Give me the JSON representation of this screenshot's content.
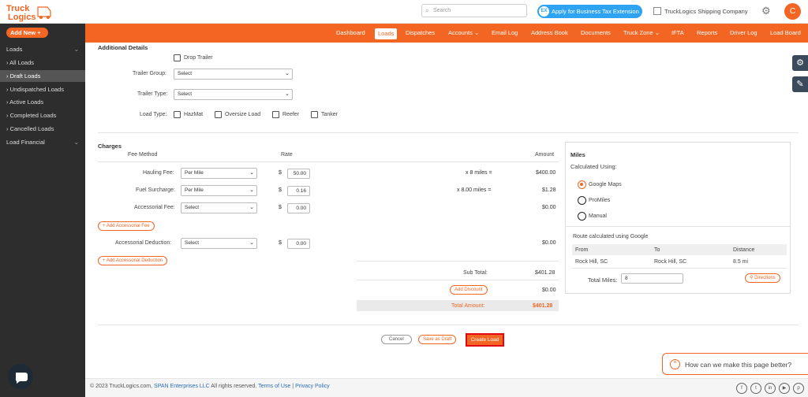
{
  "header": {
    "logo_text": "TruckLogics",
    "search_placeholder": "Search",
    "tax_button": "Apply for Business Tax Extension",
    "company": "TruckLogics Shipping Company",
    "avatar_initial": "C"
  },
  "sidebar": {
    "add_new": "Add New",
    "loads_header": "Loads",
    "items": [
      "All Loads",
      "Draft Loads",
      "Undispatched Loads",
      "Active Loads",
      "Completed Loads",
      "Cancelled Loads"
    ],
    "load_financial": "Load Financial"
  },
  "nav": [
    "Dashboard",
    "Loads",
    "Dispatches",
    "Accounts",
    "Email Log",
    "Address Book",
    "Documents",
    "Truck Zone",
    "IFTA",
    "Reports",
    "Driver Log",
    "Load Board"
  ],
  "additional": {
    "title": "Additional Details",
    "drop_trailer": "Drop Trailer",
    "trailer_group_label": "Trailer Group:",
    "trailer_group_value": "Select",
    "trailer_type_label": "Trailer Type:",
    "trailer_type_value": "Select",
    "load_type_label": "Load Type:",
    "load_types": [
      "HazMat",
      "Oversize Load",
      "Reefer",
      "Tanker"
    ]
  },
  "charges": {
    "title": "Charges",
    "col_fee_method": "Fee Method",
    "col_rate": "Rate",
    "col_amount": "Amount",
    "hauling_label": "Hauling Fee:",
    "hauling_method": "Per Mile",
    "hauling_rate": "50.00",
    "hauling_calc": "x 8 miles =",
    "hauling_amount": "$400.00",
    "fuel_label": "Fuel Surcharge:",
    "fuel_method": "Per Mile",
    "fuel_rate": "0.16",
    "fuel_calc": "x 8.00 miles =",
    "fuel_amount": "$1.28",
    "accessorial_label": "Accessorial Fee:",
    "accessorial_method": "Select",
    "accessorial_rate": "0.00",
    "accessorial_amount": "$0.00",
    "add_accessorial_fee": "+ Add Accessorial Fee",
    "deduction_label": "Accessorial Deduction:",
    "deduction_method": "Select",
    "deduction_rate": "0.00",
    "deduction_amount": "$0.00",
    "add_accessorial_deduction": "+ Add Accessorial Deduction",
    "subtotal_label": "Sub Total:",
    "subtotal_value": "$401.28",
    "add_discount": "Add Discount",
    "discount_value": "$0.00",
    "total_label": "Total Amount:",
    "total_value": "$401.28"
  },
  "miles": {
    "title": "Miles",
    "calculated_using": "Calculated Using:",
    "options": [
      "Google Maps",
      "ProMiles",
      "Manual"
    ],
    "route_text": "Route calculated using Google",
    "table_headers": [
      "From",
      "To",
      "Distance"
    ],
    "row": [
      "Rock Hill, SC",
      "Rock Hill, SC",
      "8.5 mi"
    ],
    "total_miles_label": "Total Miles:",
    "total_miles_value": "8",
    "directions": "Directions"
  },
  "actions": {
    "cancel": "Cancel",
    "save_draft": "Save as Draft",
    "create": "Create Load"
  },
  "footer": {
    "copyright": "© 2023 TruckLogics.com,",
    "span": "SPAN Enterprises LLC",
    "rights": "All rights reserved.",
    "terms": "Terms of Use",
    "sep": "|",
    "privacy": "Privacy Policy"
  },
  "feedback": "How can we make this page better?",
  "colors": {
    "brand": "#f26522",
    "sidebar": "#2d2d2d",
    "tax_button": "#2ea3f2"
  }
}
